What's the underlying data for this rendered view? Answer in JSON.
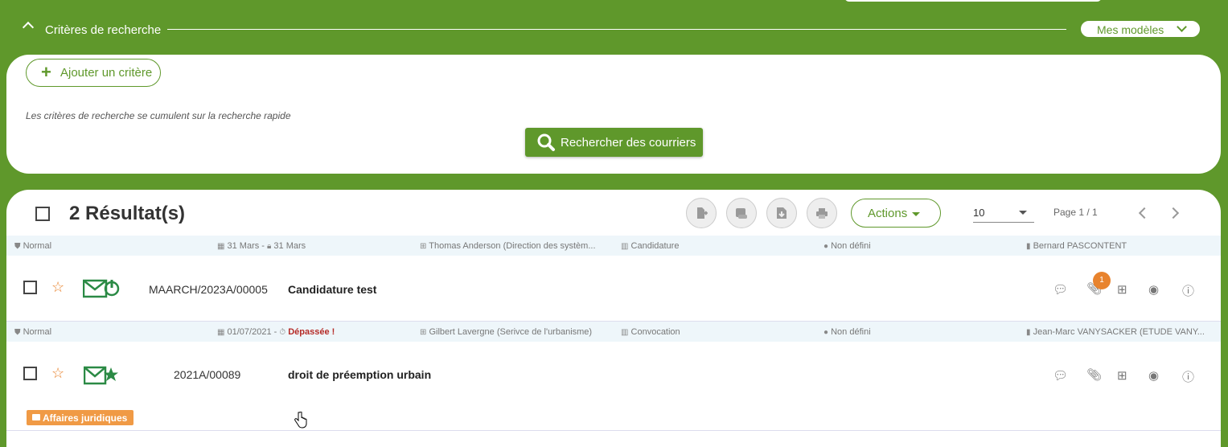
{
  "criteria": {
    "title": "Critères de recherche",
    "models_button": "Mes modèles",
    "add_button": "Ajouter un critère",
    "note": "Les critères de recherche se cumulent sur la recherche rapide",
    "search_button": "Rechercher des courriers"
  },
  "results": {
    "title": "2 Résultat(s)",
    "actions_button": "Actions",
    "per_page": "10",
    "page_info": "Page 1 / 1"
  },
  "rows": [
    {
      "priority": "Normal",
      "dates": "31 Mars - ",
      "date2": "31 Mars",
      "entity": "Thomas Anderson (Direction des systèm...",
      "doctype": "Candidature",
      "contact": "Non défini",
      "recipient": "Bernard PASCONTENT",
      "chrono": "MAARCH/2023A/00005",
      "subject": "Candidature test",
      "attachments_badge": "1"
    },
    {
      "priority": "Normal",
      "dates": "01/07/2021 - ",
      "late_label": "Dépassée !",
      "entity": "Gilbert Lavergne (Serivce de l'urbanisme)",
      "doctype": "Convocation",
      "contact": "Non défini",
      "recipient": "Jean-Marc VANYSACKER (ETUDE VANY...",
      "chrono": "2021A/00089",
      "subject": "droit de préemption urbain",
      "folder_tag": "Affaires juridiques"
    }
  ],
  "colors": {
    "brand_green": "#5f982b",
    "accent_orange": "#e8832d",
    "late_red": "#b52b27",
    "meta_bg": "#eef6fa"
  }
}
